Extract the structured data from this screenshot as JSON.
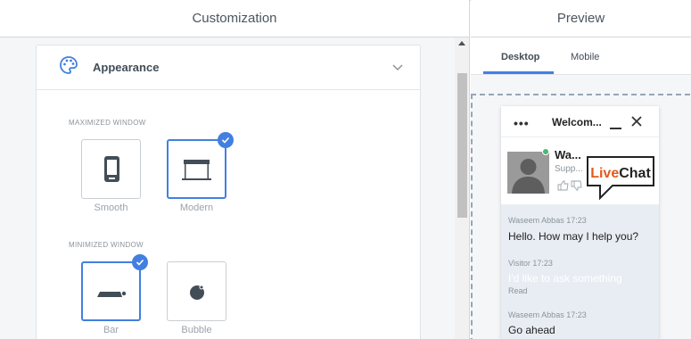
{
  "left_panel": {
    "title": "Customization",
    "card": {
      "title": "Appearance",
      "sections": [
        {
          "label": "MAXIMIZED WINDOW",
          "options": [
            {
              "label": "Smooth",
              "selected": false,
              "icon": "phone-icon"
            },
            {
              "label": "Modern",
              "selected": true,
              "icon": "window-icon"
            }
          ]
        },
        {
          "label": "MINIMIZED WINDOW",
          "options": [
            {
              "label": "Bar",
              "selected": true,
              "icon": "bar-icon"
            },
            {
              "label": "Bubble",
              "selected": false,
              "icon": "bubble-icon"
            }
          ]
        }
      ]
    }
  },
  "right_panel": {
    "title": "Preview",
    "tabs": [
      {
        "label": "Desktop",
        "active": true
      },
      {
        "label": "Mobile",
        "active": false
      }
    ],
    "widget": {
      "header_title": "Welcom...",
      "menu_glyph": "•••",
      "agent": {
        "name": "Wa...",
        "role": "Supp...",
        "status": "online"
      },
      "logo_text": "LiveChat",
      "messages": [
        {
          "meta": "Waseem Abbas 17:23",
          "text": "Hello. How may I help you?"
        },
        {
          "meta": "Visitor 17:23",
          "text": "I'd like to ask something",
          "status": "Read"
        },
        {
          "meta": "Waseem Abbas 17:23",
          "text": "Go ahead"
        }
      ]
    }
  },
  "colors": {
    "accent": "#427fe1",
    "online": "#4bb678",
    "logo_orange": "#e35a1c",
    "message_bg": "#e8edf3"
  }
}
